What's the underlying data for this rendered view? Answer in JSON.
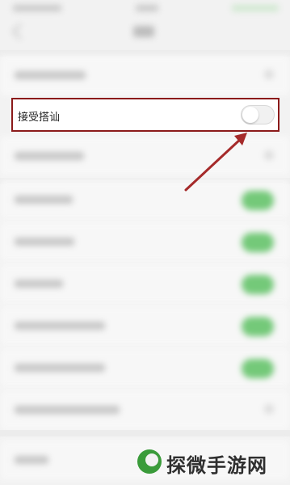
{
  "screen": {
    "bg_color": "#f2f2f2"
  },
  "highlighted_setting": {
    "label": "接受搭讪",
    "toggle_state": "off",
    "border_color": "#8b1a1a"
  },
  "blurred_rows": [
    {
      "control": "chevron"
    },
    {
      "control": "chevron"
    },
    {
      "control": "toggle-on"
    },
    {
      "control": "toggle-on"
    },
    {
      "control": "toggle-on"
    },
    {
      "control": "toggle-on"
    },
    {
      "control": "toggle-on"
    },
    {
      "control": "chevron"
    },
    {
      "control": "chevron"
    }
  ],
  "watermark": {
    "text": "探微手游网",
    "logo_color": "#3a9b3a"
  },
  "annotation": {
    "arrow_color": "#a52a2a"
  }
}
